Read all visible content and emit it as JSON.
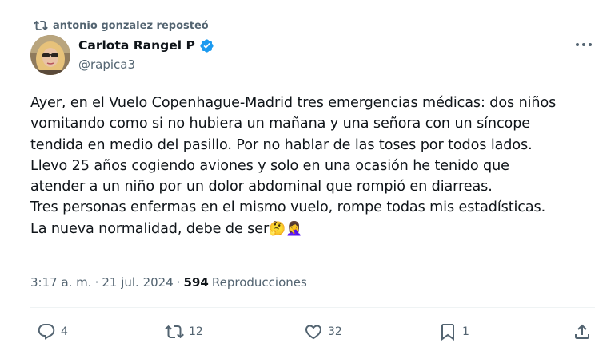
{
  "repost": {
    "text": "antonio gonzalez reposteó",
    "icon": "repost-icon"
  },
  "author": {
    "name": "Carlota Rangel P",
    "handle": "@rapica3",
    "verified_icon": "verified-badge-icon",
    "verified_color": "#1d9bf0"
  },
  "tweet": {
    "lines": [
      "Ayer, en el Vuelo Copenhague-Madrid tres emergencias médicas: dos niños",
      "vomitando como si no hubiera un mañana y una señora con un síncope",
      "tendida en medio del pasillo. Por no hablar de las toses por todos lados.",
      "Llevo 25 años cogiendo aviones y solo en una ocasión he tenido que",
      "atender a un niño por un dolor abdominal que rompió en diarreas.",
      "Tres personas enfermas en el mismo vuelo, rompe todas mis estadísticas.",
      "La nueva normalidad, debe de ser"
    ],
    "emojis": "🤔🤦‍♀️"
  },
  "meta": {
    "time": "3:17 a. m.",
    "separator": "·",
    "date": "21 jul. 2024",
    "views_count": "594",
    "views_label": "Reproducciones"
  },
  "actions": {
    "replies": "4",
    "reposts": "12",
    "likes": "32",
    "bookmarks": "1"
  },
  "colors": {
    "text": "#0f1419",
    "secondary": "#536471",
    "divider": "#eff3f4"
  }
}
